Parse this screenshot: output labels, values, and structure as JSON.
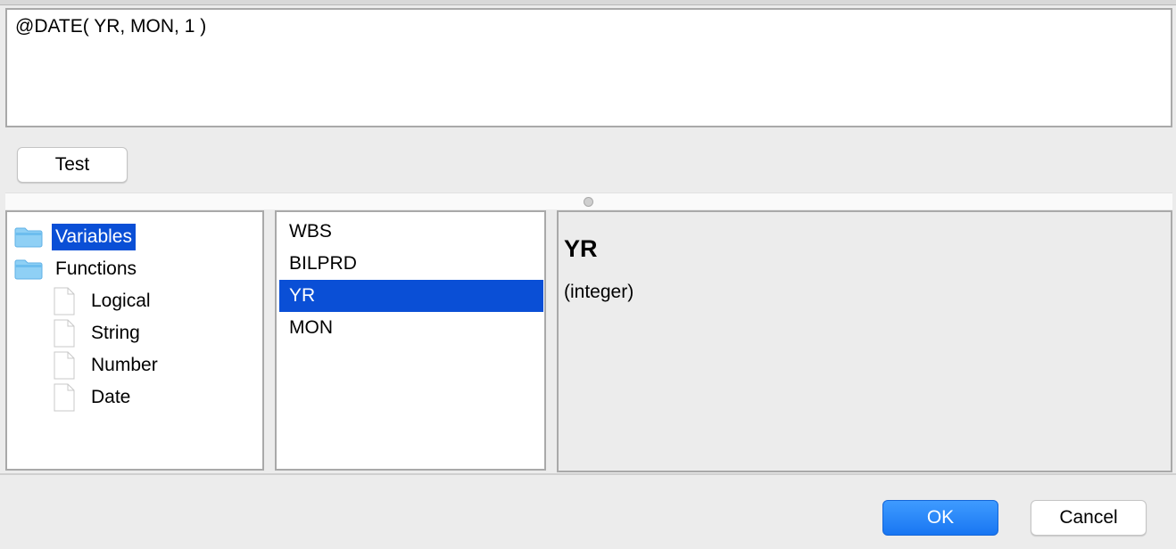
{
  "expression": {
    "text": "@DATE( YR, MON, 1 )"
  },
  "toolbar": {
    "test_label": "Test"
  },
  "tree": {
    "items": [
      {
        "label": "Variables",
        "icon": "folder-icon",
        "selected": true
      },
      {
        "label": "Functions",
        "icon": "folder-icon",
        "selected": false
      },
      {
        "label": "Logical",
        "icon": "document-icon",
        "selected": false
      },
      {
        "label": "String",
        "icon": "document-icon",
        "selected": false
      },
      {
        "label": "Number",
        "icon": "document-icon",
        "selected": false
      },
      {
        "label": "Date",
        "icon": "document-icon",
        "selected": false
      }
    ]
  },
  "variables": {
    "items": [
      {
        "label": "WBS",
        "selected": false
      },
      {
        "label": "BILPRD",
        "selected": false
      },
      {
        "label": "YR",
        "selected": true
      },
      {
        "label": "MON",
        "selected": false
      }
    ]
  },
  "detail": {
    "title": "YR",
    "type": "(integer)"
  },
  "footer": {
    "ok_label": "OK",
    "cancel_label": "Cancel"
  },
  "colors": {
    "selection": "#0a4fd6",
    "primary_button": "#1876f2",
    "folder": "#7fc6f2"
  }
}
